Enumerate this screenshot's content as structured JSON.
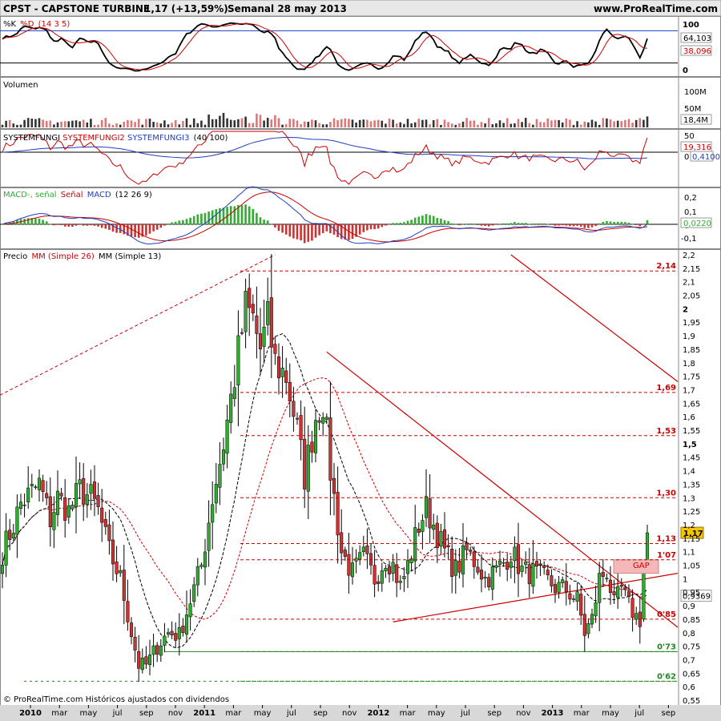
{
  "header": {
    "symbol": "CPST - CAPSTONE TURBINE",
    "last": "1,17 (+13,59%)",
    "period": "Semanal  28 may 2013",
    "site": "www.ProRealTime.com"
  },
  "footer": {
    "copyright": "© ProRealTime.com  Históricos ajustados con dividendos"
  },
  "colors": {
    "up": "#33aa33",
    "down": "#cc3333",
    "grid_red": "#cc0000",
    "green_level": "#228822",
    "blue": "#1f3fbf",
    "volume_down": "#dd7777",
    "volume_up": "#333333"
  },
  "panels": {
    "stoch": {
      "title_k": "%K",
      "title_d": "%D",
      "params": "(14 3 5)",
      "k_value": "64,103",
      "d_value": "38,096",
      "ticks": [
        "100",
        "0"
      ]
    },
    "volume": {
      "title": "Volumen",
      "value": "18,4M",
      "ticks": [
        "100M",
        "50M"
      ]
    },
    "sysfungi": {
      "title1": "SYSTEMFUNGI",
      "title2": "SYSTEMFUNGI2",
      "title3": "SYSTEMFUNGI3",
      "params": "(40 100)",
      "value_red": "19,316",
      "value_blue": "0,4100",
      "ticks": [
        "50",
        "0"
      ]
    },
    "macd": {
      "title_h": "MACD-, señal",
      "title_s": "Señal",
      "title_m": "MACD",
      "params": "(12 26 9)",
      "value": "0,0220",
      "ticks": [
        "0,2",
        "0,1",
        "0",
        "-0,1"
      ]
    },
    "price": {
      "title_p": "Precio",
      "title_mm26": "MM (Simple 26)",
      "title_mm13": "MM (Simple 13)",
      "last_value": "1,17",
      "marker_value": "0,9369",
      "gap_label": "GAP"
    }
  },
  "chart_data": {
    "type": "candlestick",
    "title": "CPST - CAPSTONE TURBINE",
    "timeframe": "Semanal",
    "y_ticks": [
      "2,2",
      "2,15",
      "2,1",
      "2,05",
      "2",
      "1,95",
      "1,9",
      "1,85",
      "1,8",
      "1,75",
      "1,7",
      "1,65",
      "1,6",
      "1,55",
      "1,5",
      "1,45",
      "1,4",
      "1,35",
      "1,3",
      "1,25",
      "1,2",
      "1,15",
      "1,1",
      "1,05",
      "1",
      "0,95",
      "0,9",
      "0,85",
      "0,8",
      "0,75",
      "0,7",
      "0,65",
      "0,6",
      "0,55"
    ],
    "ylim": [
      0.55,
      2.2
    ],
    "x_labels": [
      "2010",
      "mar",
      "may",
      "jul",
      "sep",
      "nov",
      "2011",
      "mar",
      "may",
      "jul",
      "sep",
      "nov",
      "2012",
      "mar",
      "may",
      "jul",
      "sep",
      "nov",
      "2013",
      "mar",
      "may",
      "jul",
      "sep"
    ],
    "levels": [
      {
        "label": "2,14",
        "value": 2.14,
        "color": "red"
      },
      {
        "label": "1,69",
        "value": 1.69,
        "color": "red"
      },
      {
        "label": "1,53",
        "value": 1.53,
        "color": "red"
      },
      {
        "label": "1,30",
        "value": 1.3,
        "color": "red"
      },
      {
        "label": "1,13",
        "value": 1.13,
        "color": "red"
      },
      {
        "label": "1'07",
        "value": 1.07,
        "color": "red"
      },
      {
        "label": "0'85",
        "value": 0.85,
        "color": "red"
      },
      {
        "label": "0'73",
        "value": 0.73,
        "color": "green"
      },
      {
        "label": "0'62",
        "value": 0.62,
        "color": "green"
      }
    ],
    "anchors": [
      [
        0,
        1.1
      ],
      [
        3,
        1.2
      ],
      [
        5,
        1.28
      ],
      [
        8,
        1.32
      ],
      [
        10,
        1.35
      ],
      [
        13,
        1.22
      ],
      [
        15,
        1.3
      ],
      [
        18,
        1.25
      ],
      [
        21,
        1.33
      ],
      [
        24,
        1.3
      ],
      [
        26,
        1.25
      ],
      [
        29,
        1.1
      ],
      [
        32,
        1.0
      ],
      [
        35,
        0.8
      ],
      [
        37,
        0.68
      ],
      [
        39,
        0.68
      ],
      [
        42,
        0.75
      ],
      [
        45,
        0.8
      ],
      [
        48,
        0.79
      ],
      [
        51,
        0.92
      ],
      [
        54,
        1.05
      ],
      [
        57,
        1.3
      ],
      [
        60,
        1.5
      ],
      [
        63,
        1.75
      ],
      [
        66,
        2.0
      ],
      [
        68,
        1.96
      ],
      [
        70,
        1.85
      ],
      [
        72,
        1.95
      ],
      [
        74,
        1.8
      ],
      [
        77,
        1.75
      ],
      [
        80,
        1.55
      ],
      [
        82,
        1.38
      ],
      [
        85,
        1.6
      ],
      [
        87,
        1.66
      ],
      [
        89,
        1.4
      ],
      [
        92,
        1.1
      ],
      [
        95,
        1.02
      ],
      [
        98,
        1.08
      ],
      [
        101,
        1.0
      ],
      [
        104,
        1.08
      ],
      [
        106,
        1.05
      ],
      [
        108,
        0.97
      ],
      [
        110,
        1.05
      ],
      [
        113,
        1.2
      ],
      [
        115,
        1.26
      ],
      [
        117,
        1.2
      ],
      [
        120,
        1.1
      ],
      [
        123,
        1.03
      ],
      [
        126,
        1.1
      ],
      [
        129,
        1.05
      ],
      [
        131,
        1.0
      ],
      [
        134,
        1.03
      ],
      [
        136,
        1.06
      ],
      [
        138,
        1.1
      ],
      [
        141,
        1.03
      ],
      [
        144,
        1.02
      ],
      [
        147,
        1.0
      ],
      [
        150,
        0.97
      ],
      [
        153,
        0.96
      ],
      [
        156,
        0.92
      ],
      [
        158,
        0.8
      ],
      [
        160,
        0.85
      ],
      [
        162,
        1.0
      ],
      [
        164,
        1.03
      ],
      [
        166,
        0.9
      ],
      [
        168,
        0.96
      ],
      [
        170,
        0.9
      ],
      [
        172,
        0.86
      ],
      [
        173,
        0.85
      ],
      [
        174,
        1.02
      ],
      [
        175,
        1.17
      ]
    ]
  }
}
